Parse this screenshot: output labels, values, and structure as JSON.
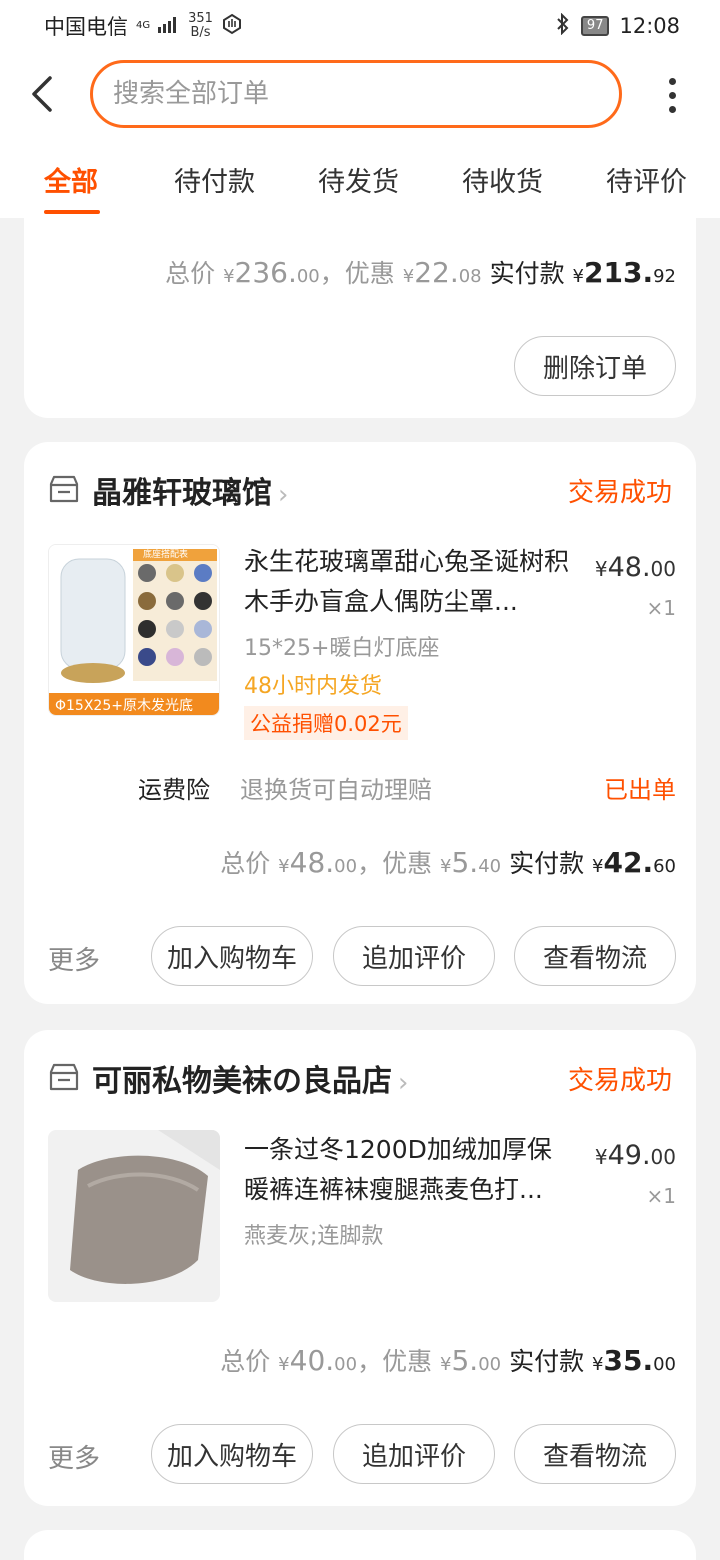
{
  "status_bar": {
    "carrier": "中国电信",
    "signal": "4G",
    "net_speed_value": "351",
    "net_speed_unit": "B/s",
    "battery": "97",
    "time": "12:08"
  },
  "search": {
    "placeholder": "搜索全部订单"
  },
  "tabs": [
    "全部",
    "待付款",
    "待发货",
    "待收货",
    "待评价"
  ],
  "orders": [
    {
      "total_label": "总价",
      "total_int": "236.",
      "total_dec": "00",
      "discount_label": "，优惠",
      "discount_int": "22.",
      "discount_dec": "08",
      "paid_label": "实付款",
      "paid_int": "213.",
      "paid_dec": "92",
      "button": "删除订单"
    },
    {
      "shop": "晶雅轩玻璃馆",
      "status": "交易成功",
      "title": "永生花玻璃罩甜心兔圣诞树积木手办盲盒人偶防尘罩...",
      "price_int": "48.",
      "price_dec": "00",
      "qty": "×1",
      "sku": "15*25+暖白灯底座",
      "ship": "48小时内发货",
      "charity": "公益捐赠0.02元",
      "insurance_label": "运费险",
      "insurance_desc": "退换货可自动理赔",
      "insurance_status": "已出单",
      "total_label": "总价",
      "total_int": "48.",
      "total_dec": "00",
      "discount_label": "，优惠",
      "discount_int": "5.",
      "discount_dec": "40",
      "paid_label": "实付款",
      "paid_int": "42.",
      "paid_dec": "60",
      "more": "更多",
      "btn_cart": "加入购物车",
      "btn_review": "追加评价",
      "btn_logistics": "查看物流",
      "thumb_caption_top": "底座搭配表",
      "thumb_caption_bottom": "Φ15X25+原木发光底"
    },
    {
      "shop": "可丽私物美袜の良品店",
      "status": "交易成功",
      "title": "一条过冬1200D加绒加厚保暖裤连裤袜瘦腿燕麦色打...",
      "price_int": "49.",
      "price_dec": "00",
      "qty": "×1",
      "sku": "燕麦灰;连脚款",
      "total_label": "总价",
      "total_int": "40.",
      "total_dec": "00",
      "discount_label": "，优惠",
      "discount_int": "5.",
      "discount_dec": "00",
      "paid_label": "实付款",
      "paid_int": "35.",
      "paid_dec": "00",
      "more": "更多",
      "btn_cart": "加入购物车",
      "btn_review": "追加评价",
      "btn_logistics": "查看物流"
    }
  ],
  "currency": "¥",
  "colors": {
    "accent": "#ff5000",
    "ship": "#f5a623",
    "muted": "#999999"
  }
}
